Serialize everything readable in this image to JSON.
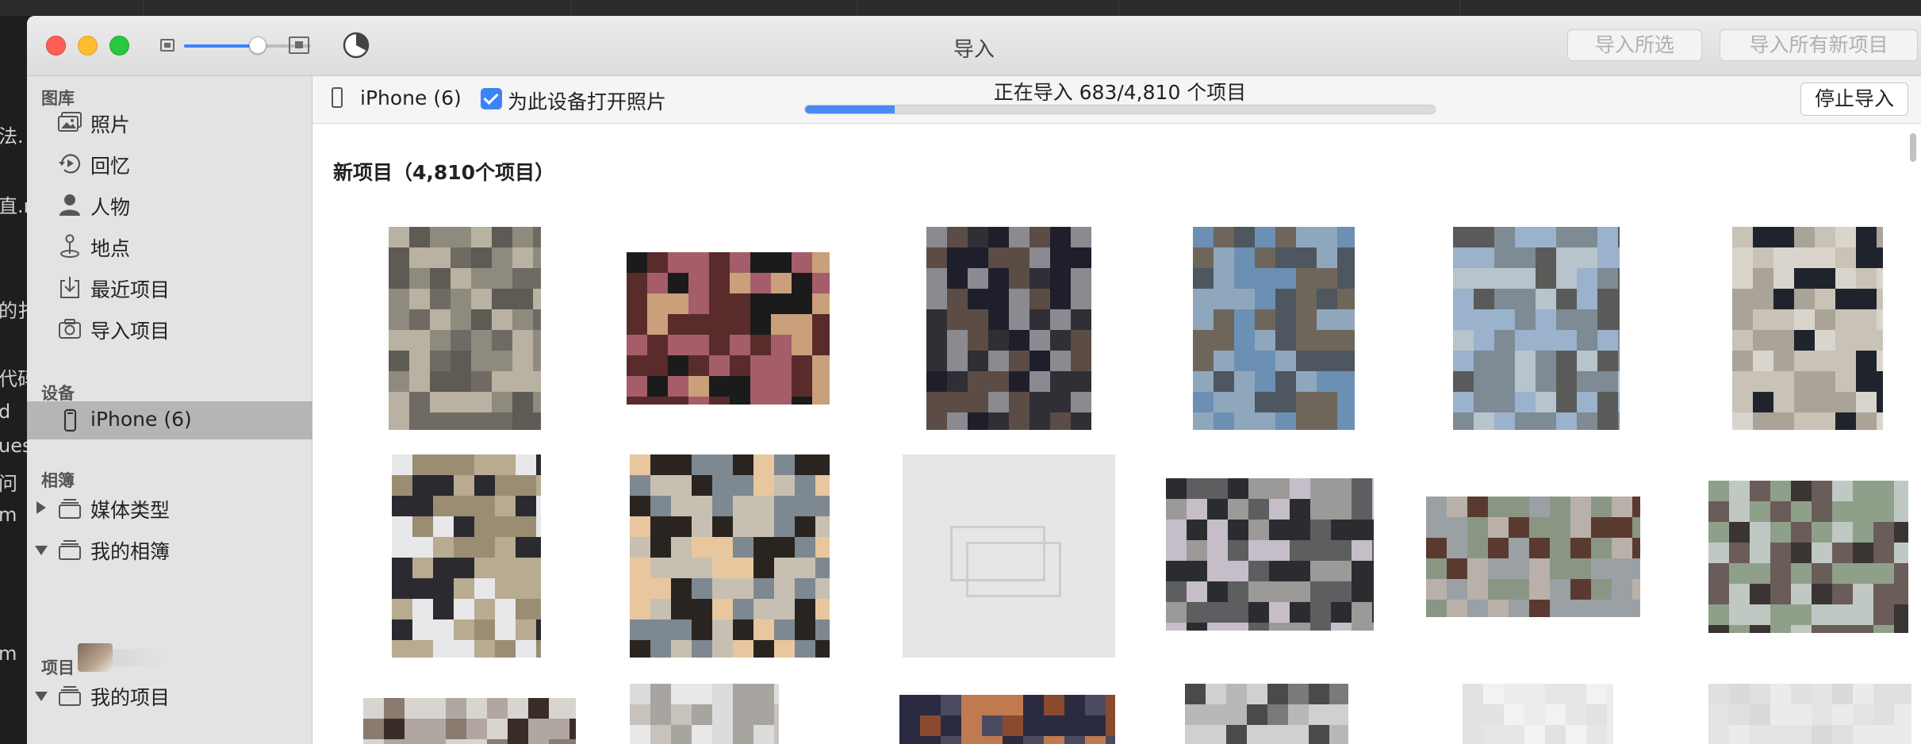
{
  "window": {
    "title": "导入",
    "buttons": {
      "import_selected": "导入所选",
      "import_all_new": "导入所有新项目"
    },
    "thumbnail_size_percent": 58
  },
  "background_fragments": [
    "法.",
    "直.n",
    "的扌",
    "代码",
    "d",
    "ues",
    "问",
    "m",
    "m"
  ],
  "sidebar": {
    "sections": {
      "library": "图库",
      "devices": "设备",
      "albums": "相簿",
      "projects": "项目"
    },
    "library_items": [
      {
        "label": "照片",
        "icon": "photos-icon"
      },
      {
        "label": "回忆",
        "icon": "memories-icon"
      },
      {
        "label": "人物",
        "icon": "people-icon"
      },
      {
        "label": "地点",
        "icon": "places-icon"
      },
      {
        "label": "最近项目",
        "icon": "recent-icon"
      },
      {
        "label": "导入项目",
        "icon": "imports-icon"
      }
    ],
    "device_item": {
      "label": "iPhone (6)",
      "icon": "iphone-icon",
      "selected": true
    },
    "album_items": [
      {
        "label": "媒体类型",
        "icon": "album-stack-icon",
        "expanded": false
      },
      {
        "label": "我的相簿",
        "icon": "album-stack-icon",
        "expanded": true
      }
    ],
    "project_items": [
      {
        "label": "我的项目",
        "icon": "album-stack-icon",
        "expanded": true
      }
    ]
  },
  "import_bar": {
    "device": "iPhone (6)",
    "open_photos_checkbox": {
      "label": "为此设备打开照片",
      "checked": true
    },
    "progress": {
      "label": "正在导入 683/4,810 个项目",
      "current": 683,
      "total": 4810
    },
    "stop_button": "停止导入"
  },
  "content": {
    "title": "新项目（4,810个项目）",
    "photos_visible_count": 18
  },
  "colors": {
    "accent": "#3d83f6",
    "close": "#fe5f57",
    "minimize": "#febc2e",
    "zoom": "#28c840"
  }
}
